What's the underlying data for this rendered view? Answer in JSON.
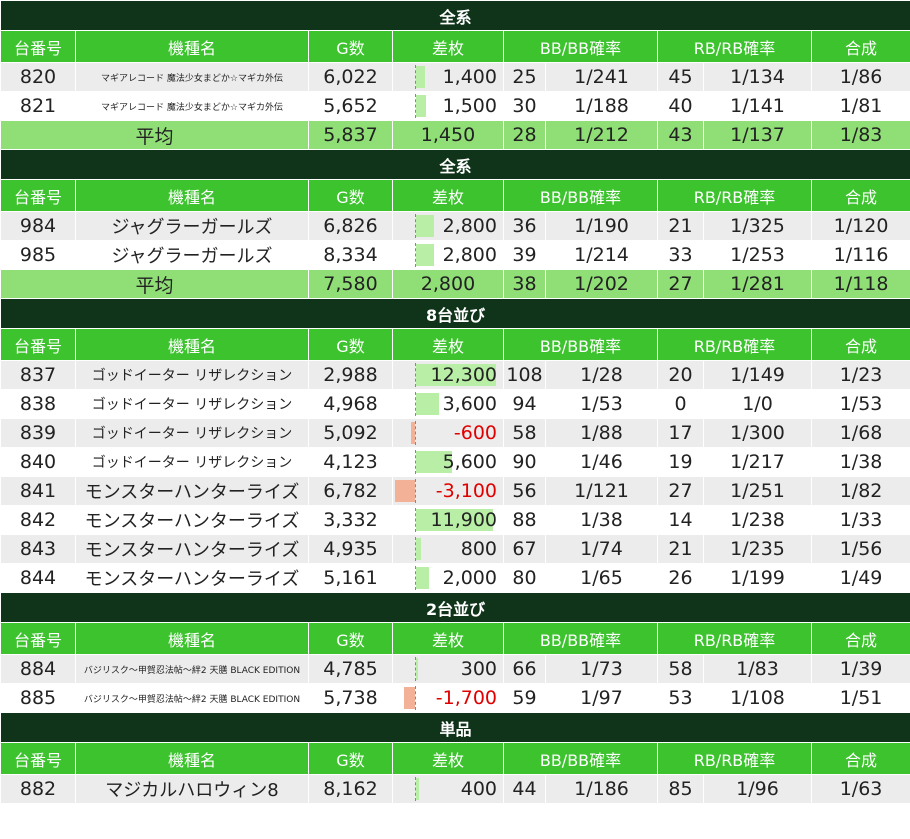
{
  "headers": [
    "台番号",
    "機種名",
    "G数",
    "差枚",
    "BB/BB確率",
    "RB/RB確率",
    "合成"
  ],
  "avg_label": "平均",
  "colors": {
    "title_bg": "#10341a",
    "header_bg": "#3cc32e",
    "avg_bg": "#8fde76",
    "pos_bar": "#b8eea5",
    "neg_bar": "#f3b197",
    "neg_text": "#e00000"
  },
  "max_abs_diff": 12300,
  "sections": [
    {
      "title": "全系",
      "rows": [
        {
          "no": "820",
          "name": "マギアレコード 魔法少女まどか☆マギカ外伝",
          "size": "s10",
          "g": "6,022",
          "diff": "1,400",
          "diff_val": 1400,
          "bb": "25",
          "bbp": "1/241",
          "rb": "45",
          "rbp": "1/134",
          "total": "1/86"
        },
        {
          "no": "821",
          "name": "マギアレコード 魔法少女まどか☆マギカ外伝",
          "size": "s10",
          "g": "5,652",
          "diff": "1,500",
          "diff_val": 1500,
          "bb": "30",
          "bbp": "1/188",
          "rb": "40",
          "rbp": "1/141",
          "total": "1/81"
        }
      ],
      "avg": {
        "g": "5,837",
        "diff": "1,450",
        "bb": "28",
        "bbp": "1/212",
        "rb": "43",
        "rbp": "1/137",
        "total": "1/83"
      }
    },
    {
      "title": "全系",
      "rows": [
        {
          "no": "984",
          "name": "ジャグラーガールズ",
          "size": "",
          "g": "6,826",
          "diff": "2,800",
          "diff_val": 2800,
          "bb": "36",
          "bbp": "1/190",
          "rb": "21",
          "rbp": "1/325",
          "total": "1/120"
        },
        {
          "no": "985",
          "name": "ジャグラーガールズ",
          "size": "",
          "g": "8,334",
          "diff": "2,800",
          "diff_val": 2800,
          "bb": "39",
          "bbp": "1/214",
          "rb": "33",
          "rbp": "1/253",
          "total": "1/116"
        }
      ],
      "avg": {
        "g": "7,580",
        "diff": "2,800",
        "bb": "38",
        "bbp": "1/202",
        "rb": "27",
        "rbp": "1/281",
        "total": "1/118"
      }
    },
    {
      "title": "8台並び",
      "rows": [
        {
          "no": "837",
          "name": "ゴッドイーター リザレクション",
          "size": "s14",
          "g": "2,988",
          "diff": "12,300",
          "diff_val": 12300,
          "bb": "108",
          "bbp": "1/28",
          "rb": "20",
          "rbp": "1/149",
          "total": "1/23"
        },
        {
          "no": "838",
          "name": "ゴッドイーター リザレクション",
          "size": "s14",
          "g": "4,968",
          "diff": "3,600",
          "diff_val": 3600,
          "bb": "94",
          "bbp": "1/53",
          "rb": "0",
          "rbp": "1/0",
          "total": "1/53"
        },
        {
          "no": "839",
          "name": "ゴッドイーター リザレクション",
          "size": "s14",
          "g": "5,092",
          "diff": "-600",
          "diff_val": -600,
          "bb": "58",
          "bbp": "1/88",
          "rb": "17",
          "rbp": "1/300",
          "total": "1/68"
        },
        {
          "no": "840",
          "name": "ゴッドイーター リザレクション",
          "size": "s14",
          "g": "4,123",
          "diff": "5,600",
          "diff_val": 5600,
          "bb": "90",
          "bbp": "1/46",
          "rb": "19",
          "rbp": "1/217",
          "total": "1/38"
        },
        {
          "no": "841",
          "name": "モンスターハンターライズ",
          "size": "",
          "g": "6,782",
          "diff": "-3,100",
          "diff_val": -3100,
          "bb": "56",
          "bbp": "1/121",
          "rb": "27",
          "rbp": "1/251",
          "total": "1/82"
        },
        {
          "no": "842",
          "name": "モンスターハンターライズ",
          "size": "",
          "g": "3,332",
          "diff": "11,900",
          "diff_val": 11900,
          "bb": "88",
          "bbp": "1/38",
          "rb": "14",
          "rbp": "1/238",
          "total": "1/33"
        },
        {
          "no": "843",
          "name": "モンスターハンターライズ",
          "size": "",
          "g": "4,935",
          "diff": "800",
          "diff_val": 800,
          "bb": "67",
          "bbp": "1/74",
          "rb": "21",
          "rbp": "1/235",
          "total": "1/56"
        },
        {
          "no": "844",
          "name": "モンスターハンターライズ",
          "size": "",
          "g": "5,161",
          "diff": "2,000",
          "diff_val": 2000,
          "bb": "80",
          "bbp": "1/65",
          "rb": "26",
          "rbp": "1/199",
          "total": "1/49"
        }
      ]
    },
    {
      "title": "2台並び",
      "rows": [
        {
          "no": "884",
          "name": "バジリスク～甲賀忍法帖～絆2 天膳 BLACK EDITION",
          "size": "s10",
          "g": "4,785",
          "diff": "300",
          "diff_val": 300,
          "bb": "66",
          "bbp": "1/73",
          "rb": "58",
          "rbp": "1/83",
          "total": "1/39"
        },
        {
          "no": "885",
          "name": "バジリスク～甲賀忍法帖～絆2 天膳 BLACK EDITION",
          "size": "s10",
          "g": "5,738",
          "diff": "-1,700",
          "diff_val": -1700,
          "bb": "59",
          "bbp": "1/97",
          "rb": "53",
          "rbp": "1/108",
          "total": "1/51"
        }
      ]
    },
    {
      "title": "単品",
      "rows": [
        {
          "no": "882",
          "name": "マジカルハロウィン8",
          "size": "",
          "g": "8,162",
          "diff": "400",
          "diff_val": 400,
          "bb": "44",
          "bbp": "1/186",
          "rb": "85",
          "rbp": "1/96",
          "total": "1/63"
        }
      ]
    }
  ]
}
